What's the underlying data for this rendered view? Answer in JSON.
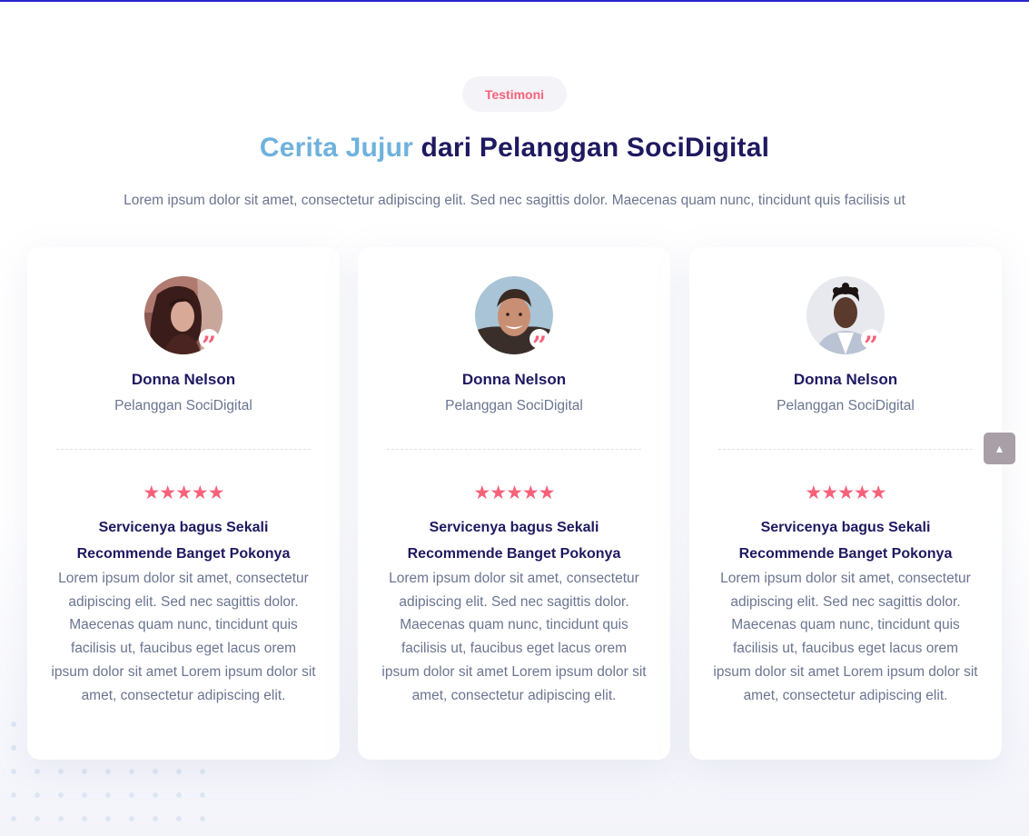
{
  "section": {
    "badge": "Testimoni",
    "title_accent": "Cerita Jujur",
    "title_rest": " dari Pelanggan SociDigital",
    "subtitle": "Lorem ipsum dolor sit amet, consectetur adipiscing elit. Sed nec sagittis dolor. Maecenas quam nunc, tincidunt quis facilisis ut"
  },
  "testimonials": [
    {
      "name": "Donna Nelson",
      "role": "Pelanggan SociDigital",
      "rating": 5,
      "stars": "★★★★★",
      "headline_line1": "Servicenya bagus Sekali",
      "headline_line2": "Recommende Banget Pokonya",
      "body": "Lorem ipsum dolor sit amet, consectetur adipiscing elit. Sed nec sagittis dolor. Maecenas quam nunc, tincidunt quis facilisis ut, faucibus eget lacus orem ipsum dolor sit amet Lorem ipsum dolor sit amet, consectetur adipiscing elit.",
      "avatar_icon": "woman-portrait-avatar",
      "quote_icon": "quote-icon"
    },
    {
      "name": "Donna Nelson",
      "role": "Pelanggan SociDigital",
      "rating": 5,
      "stars": "★★★★★",
      "headline_line1": "Servicenya bagus Sekali",
      "headline_line2": "Recommende Banget Pokonya",
      "body": "Lorem ipsum dolor sit amet, consectetur adipiscing elit. Sed nec sagittis dolor. Maecenas quam nunc, tincidunt quis facilisis ut, faucibus eget lacus orem ipsum dolor sit amet Lorem ipsum dolor sit amet, consectetur adipiscing elit.",
      "avatar_icon": "man-portrait-avatar",
      "quote_icon": "quote-icon"
    },
    {
      "name": "Donna Nelson",
      "role": "Pelanggan SociDigital",
      "rating": 5,
      "stars": "★★★★★",
      "headline_line1": "Servicenya bagus Sekali",
      "headline_line2": "Recommende Banget Pokonya",
      "body": "Lorem ipsum dolor sit amet, consectetur adipiscing elit. Sed nec sagittis dolor. Maecenas quam nunc, tincidunt quis facilisis ut, faucibus eget lacus orem ipsum dolor sit amet Lorem ipsum dolor sit amet, consectetur adipiscing elit.",
      "avatar_icon": "man-portrait-avatar",
      "quote_icon": "quote-icon"
    }
  ],
  "scroll_top": {
    "icon": "chevron-up-icon",
    "glyph": "▲"
  },
  "colors": {
    "accent_pink": "#f5627a",
    "heading_navy": "#1f1960",
    "accent_blue": "#6fb2dd",
    "body_gray": "#6b7591",
    "top_line": "#2a25c9"
  }
}
